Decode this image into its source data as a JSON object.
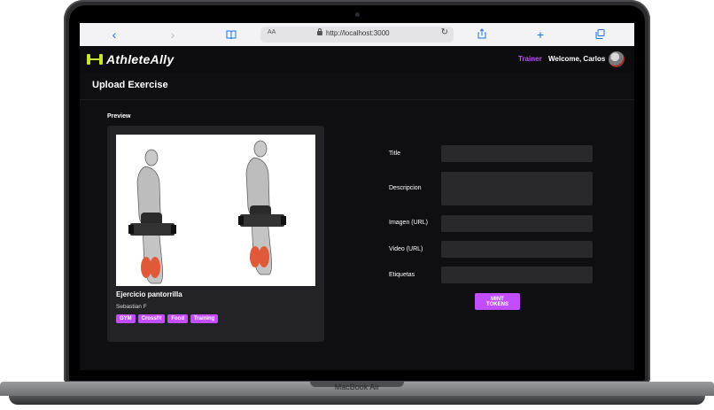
{
  "device": {
    "model": "MacBook Air"
  },
  "browser": {
    "text_size_label": "AA",
    "url": "http://localhost:3000"
  },
  "app": {
    "brand": "AthleteAlly",
    "nav": {
      "role": "Trainer",
      "welcome": "Welcome, Carlos"
    },
    "page_title": "Upload Exercise"
  },
  "preview": {
    "label": "Preview",
    "card": {
      "title": "Ejercicio pantorrilla",
      "author": "Sebastian F",
      "tags": [
        "GYM",
        "Crossfit",
        "Food",
        "Training"
      ]
    }
  },
  "form": {
    "title_label": "Title",
    "description_label": "Descripcion",
    "image_label": "Imagen (URL)",
    "video_label": "Video (URL)",
    "tags_label": "Etiquetas",
    "submit_label": "MINT TOKENS"
  },
  "colors": {
    "accent": "#c14dff",
    "brand": "#c8e62d",
    "muscle": "#e05a3a"
  }
}
